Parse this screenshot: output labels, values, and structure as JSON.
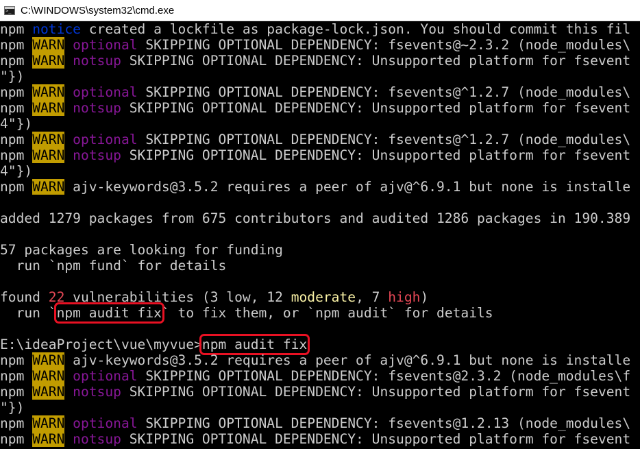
{
  "window": {
    "title": "C:\\WINDOWS\\system32\\cmd.exe",
    "icon": "cmd-icon"
  },
  "colors": {
    "warn_bg": "#c19c00",
    "notice": "#0037da",
    "optional": "#881798",
    "high": "#e74856",
    "moderate": "#f9f1a5",
    "annotation": "#e81123"
  },
  "lines": [
    [
      {
        "t": "npm "
      },
      {
        "t": "notice",
        "c": "blue"
      },
      {
        "t": " created a lockfile as package-lock.json. You should commit this fil"
      }
    ],
    [
      {
        "t": "npm "
      },
      {
        "t": "WARN",
        "c": "warn"
      },
      {
        "t": " "
      },
      {
        "t": "optional",
        "c": "purple"
      },
      {
        "t": " SKIPPING OPTIONAL DEPENDENCY: fsevents@~2.3.2 (node_modules\\"
      }
    ],
    [
      {
        "t": "npm "
      },
      {
        "t": "WARN",
        "c": "warn"
      },
      {
        "t": " "
      },
      {
        "t": "notsup",
        "c": "purple"
      },
      {
        "t": " SKIPPING OPTIONAL DEPENDENCY: Unsupported platform for fsevent"
      }
    ],
    [
      {
        "t": "\"})"
      }
    ],
    [
      {
        "t": "npm "
      },
      {
        "t": "WARN",
        "c": "warn"
      },
      {
        "t": " "
      },
      {
        "t": "optional",
        "c": "purple"
      },
      {
        "t": " SKIPPING OPTIONAL DEPENDENCY: fsevents@^1.2.7 (node_modules\\"
      }
    ],
    [
      {
        "t": "npm "
      },
      {
        "t": "WARN",
        "c": "warn"
      },
      {
        "t": " "
      },
      {
        "t": "notsup",
        "c": "purple"
      },
      {
        "t": " SKIPPING OPTIONAL DEPENDENCY: Unsupported platform for fsevent"
      }
    ],
    [
      {
        "t": "4\"})"
      }
    ],
    [
      {
        "t": "npm "
      },
      {
        "t": "WARN",
        "c": "warn"
      },
      {
        "t": " "
      },
      {
        "t": "optional",
        "c": "purple"
      },
      {
        "t": " SKIPPING OPTIONAL DEPENDENCY: fsevents@^1.2.7 (node_modules\\"
      }
    ],
    [
      {
        "t": "npm "
      },
      {
        "t": "WARN",
        "c": "warn"
      },
      {
        "t": " "
      },
      {
        "t": "notsup",
        "c": "purple"
      },
      {
        "t": " SKIPPING OPTIONAL DEPENDENCY: Unsupported platform for fsevent"
      }
    ],
    [
      {
        "t": "4\"})"
      }
    ],
    [
      {
        "t": "npm "
      },
      {
        "t": "WARN",
        "c": "warn"
      },
      {
        "t": " ajv-keywords@3.5.2 requires a peer of ajv@^6.9.1 but none is installe"
      }
    ],
    [],
    [
      {
        "t": "added 1279 packages from 675 contributors and audited 1286 packages in 190.389"
      }
    ],
    [],
    [
      {
        "t": "57 packages are looking for funding"
      }
    ],
    [
      {
        "t": "  run `npm fund` for details"
      }
    ],
    [],
    [
      {
        "t": "found "
      },
      {
        "t": "22",
        "c": "red"
      },
      {
        "t": " vulnerabilities (3 low, 12 "
      },
      {
        "t": "moderate",
        "c": "yellow"
      },
      {
        "t": ", 7 "
      },
      {
        "t": "high",
        "c": "red"
      },
      {
        "t": ")"
      }
    ],
    [
      {
        "t": "  run `"
      },
      {
        "t": "npm audit fix",
        "c": "hl"
      },
      {
        "t": "` to fix them, or `npm audit` for details"
      }
    ],
    [],
    [
      {
        "t": "E:\\ideaProject\\vue\\myvue>"
      },
      {
        "t": "npm audit fix",
        "c": "hl"
      }
    ],
    [
      {
        "t": "npm "
      },
      {
        "t": "WARN",
        "c": "warn"
      },
      {
        "t": " ajv-keywords@3.5.2 requires a peer of ajv@^6.9.1 but none is installe"
      }
    ],
    [
      {
        "t": "npm "
      },
      {
        "t": "WARN",
        "c": "warn"
      },
      {
        "t": " "
      },
      {
        "t": "optional",
        "c": "purple"
      },
      {
        "t": " SKIPPING OPTIONAL DEPENDENCY: fsevents@2.3.2 (node_modules\\f"
      }
    ],
    [
      {
        "t": "npm "
      },
      {
        "t": "WARN",
        "c": "warn"
      },
      {
        "t": " "
      },
      {
        "t": "notsup",
        "c": "purple"
      },
      {
        "t": " SKIPPING OPTIONAL DEPENDENCY: Unsupported platform for fsevent"
      }
    ],
    [
      {
        "t": "\"})"
      }
    ],
    [
      {
        "t": "npm "
      },
      {
        "t": "WARN",
        "c": "warn"
      },
      {
        "t": " "
      },
      {
        "t": "optional",
        "c": "purple"
      },
      {
        "t": " SKIPPING OPTIONAL DEPENDENCY: fsevents@1.2.13 (node_modules\\"
      }
    ],
    [
      {
        "t": "npm "
      },
      {
        "t": "WARN",
        "c": "warn"
      },
      {
        "t": " "
      },
      {
        "t": "notsup",
        "c": "purple"
      },
      {
        "t": " SKIPPING OPTIONAL DEPENDENCY: Unsupported platform for fsevent"
      }
    ],
    [
      {
        "t": "\"})"
      }
    ]
  ]
}
